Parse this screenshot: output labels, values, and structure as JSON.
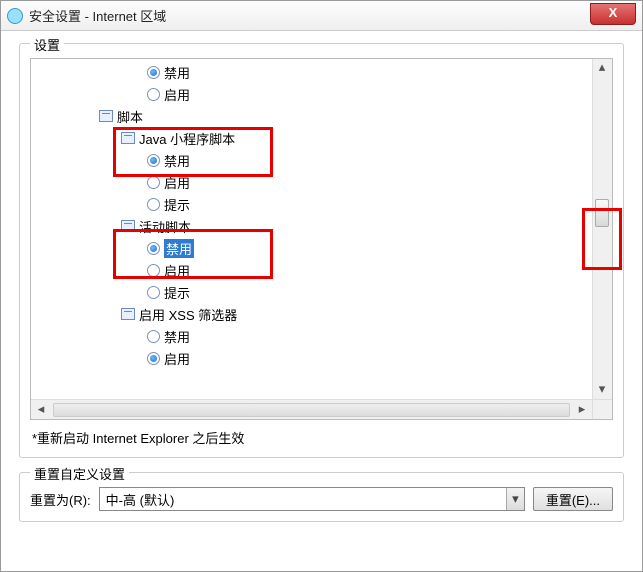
{
  "window": {
    "title": "安全设置 - Internet 区域",
    "close_label": "X"
  },
  "settings": {
    "group_title": "设置",
    "note": "*重新启动 Internet Explorer 之后生效",
    "items": {
      "top_disable": "禁用",
      "top_enable": "启用",
      "script_category": "脚本",
      "java_title": "Java 小程序脚本",
      "java_disable": "禁用",
      "java_enable": "启用",
      "java_prompt": "提示",
      "active_title": "活动脚本",
      "active_disable": "禁用",
      "active_enable": "启用",
      "active_prompt": "提示",
      "xss_title": "启用 XSS 筛选器",
      "xss_disable": "禁用",
      "xss_enable": "启用"
    }
  },
  "reset": {
    "group_title": "重置自定义设置",
    "label": "重置为(R):",
    "value": "中-高 (默认)",
    "button": "重置(E)..."
  }
}
